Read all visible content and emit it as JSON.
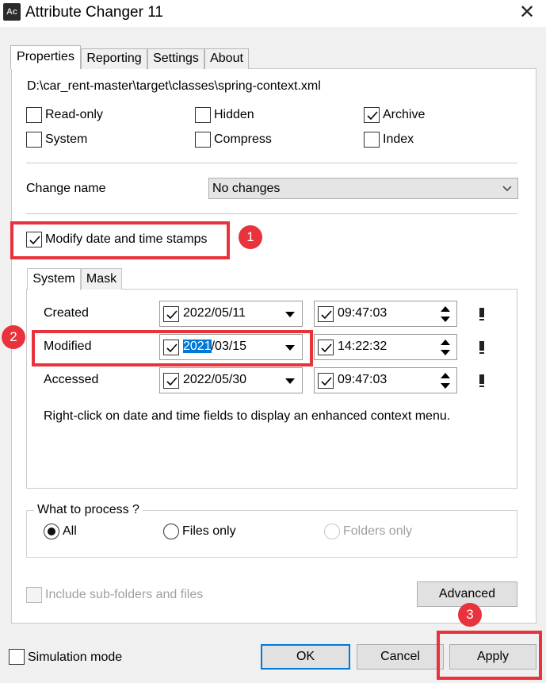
{
  "window": {
    "title": "Attribute Changer 11",
    "icon_text": "Ac"
  },
  "tabs": [
    "Properties",
    "Reporting",
    "Settings",
    "About"
  ],
  "file_path": "D:\\car_rent-master\\target\\classes\\spring-context.xml",
  "attributes": {
    "read_only": {
      "label": "Read-only",
      "checked": false
    },
    "hidden": {
      "label": "Hidden",
      "checked": false
    },
    "archive": {
      "label": "Archive",
      "checked": true
    },
    "system": {
      "label": "System",
      "checked": false
    },
    "compress": {
      "label": "Compress",
      "checked": false
    },
    "index": {
      "label": "Index",
      "checked": false
    }
  },
  "change_name": {
    "label": "Change name",
    "value": "No changes"
  },
  "modify_stamps": {
    "label": "Modify date and time stamps",
    "checked": true
  },
  "subtabs": [
    "System",
    "Mask"
  ],
  "stamps": {
    "created": {
      "label": "Created",
      "date": "2022/05/11",
      "time": "09:47:03"
    },
    "modified": {
      "label": "Modified",
      "date_year": "2021",
      "date_rest": "/03/15",
      "time": "14:22:32"
    },
    "accessed": {
      "label": "Accessed",
      "date": "2022/05/30",
      "time": "09:47:03"
    }
  },
  "hint": "Right-click on date and time fields to display an enhanced context menu.",
  "what_to_process": {
    "title": "What to process ?",
    "options": [
      "All",
      "Files only",
      "Folders only"
    ],
    "selected": "All"
  },
  "include_subfolders": {
    "label": "Include sub-folders and files",
    "checked": false,
    "enabled": false
  },
  "buttons": {
    "advanced": "Advanced",
    "ok": "OK",
    "cancel": "Cancel",
    "apply": "Apply"
  },
  "simulation_mode": {
    "label": "Simulation mode",
    "checked": false
  },
  "annotations": [
    "1",
    "2",
    "3"
  ],
  "colors": {
    "annotation_red": "#e8323c",
    "selection_blue": "#0078d7"
  }
}
